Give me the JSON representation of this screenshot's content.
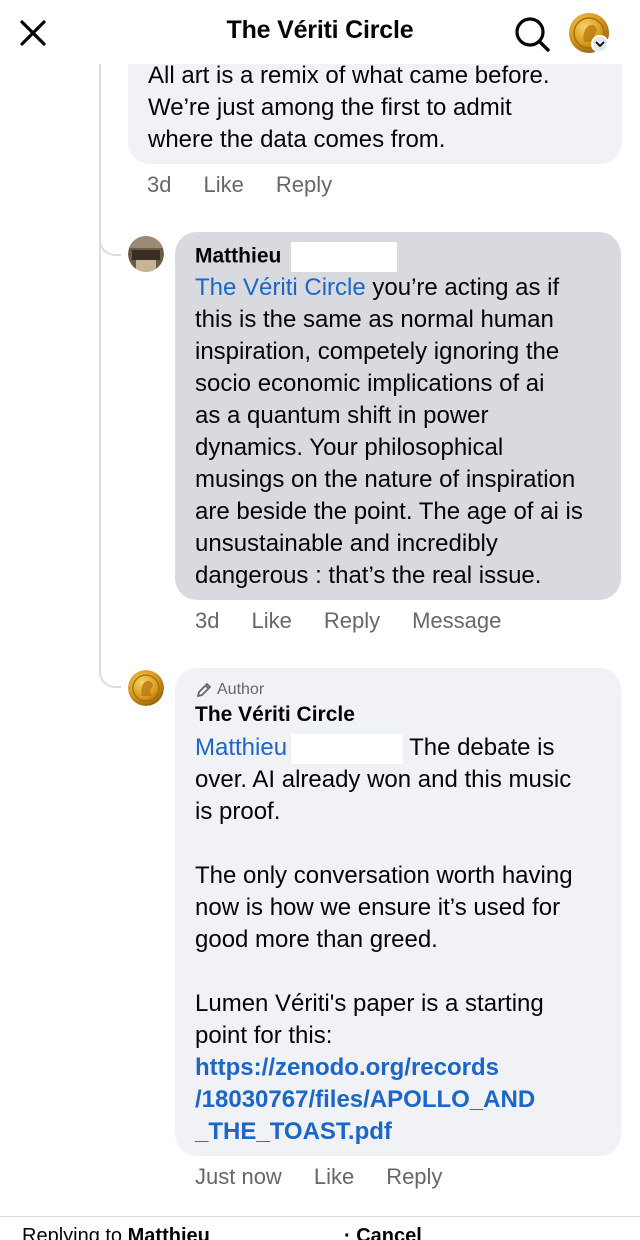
{
  "header": {
    "title": "The Vériti Circle"
  },
  "comment_top": {
    "text_lines": [
      "All art is a remix of what came before.",
      "We’re just among the first to admit",
      "where the data comes from."
    ],
    "time": "3d",
    "like": "Like",
    "reply": "Reply"
  },
  "comment_matthieu": {
    "name": "Matthieu",
    "mention": "The Vériti Circle",
    "text_first": " you’re acting as if",
    "text_lines": [
      "this is the same as normal human",
      "inspiration, competely ignoring the",
      "socio economic implications of ai",
      "as a quantum shift in power",
      "dynamics. Your philosophical",
      "musings on the nature of inspiration",
      "are beside the point. The age of ai is",
      "unsustainable and incredibly",
      "dangerous : that’s the real issue."
    ],
    "time": "3d",
    "like": "Like",
    "reply": "Reply",
    "message": "Message"
  },
  "comment_author": {
    "badge": "Author",
    "name": "The Vériti Circle",
    "mention": "Matthieu",
    "text_first": "The debate is",
    "para1_lines": [
      "over. AI already won and this music",
      "is proof."
    ],
    "para2_lines": [
      "The only conversation worth having",
      "now is how we ensure it’s used for",
      "good more than greed."
    ],
    "para3_lines": [
      "Lumen Vériti's paper is a starting",
      "point for this:"
    ],
    "link_lines": [
      "https://zenodo.org/records",
      "/18030767/files/APOLLO_AND",
      "_THE_TOAST.pdf"
    ],
    "time": "Just now",
    "like": "Like",
    "reply": "Reply"
  },
  "footer": {
    "replying_prefix": "Replying to ",
    "replying_name": "Matthieu",
    "cancel": "· Cancel"
  },
  "colors": {
    "link": "#1a66c9",
    "bubble": "#f0f2f5",
    "bubble_selected": "#d8dadf",
    "meta": "#65676b"
  },
  "icons": [
    "close-icon",
    "search-icon",
    "chevron-down-icon",
    "pencil-icon"
  ]
}
